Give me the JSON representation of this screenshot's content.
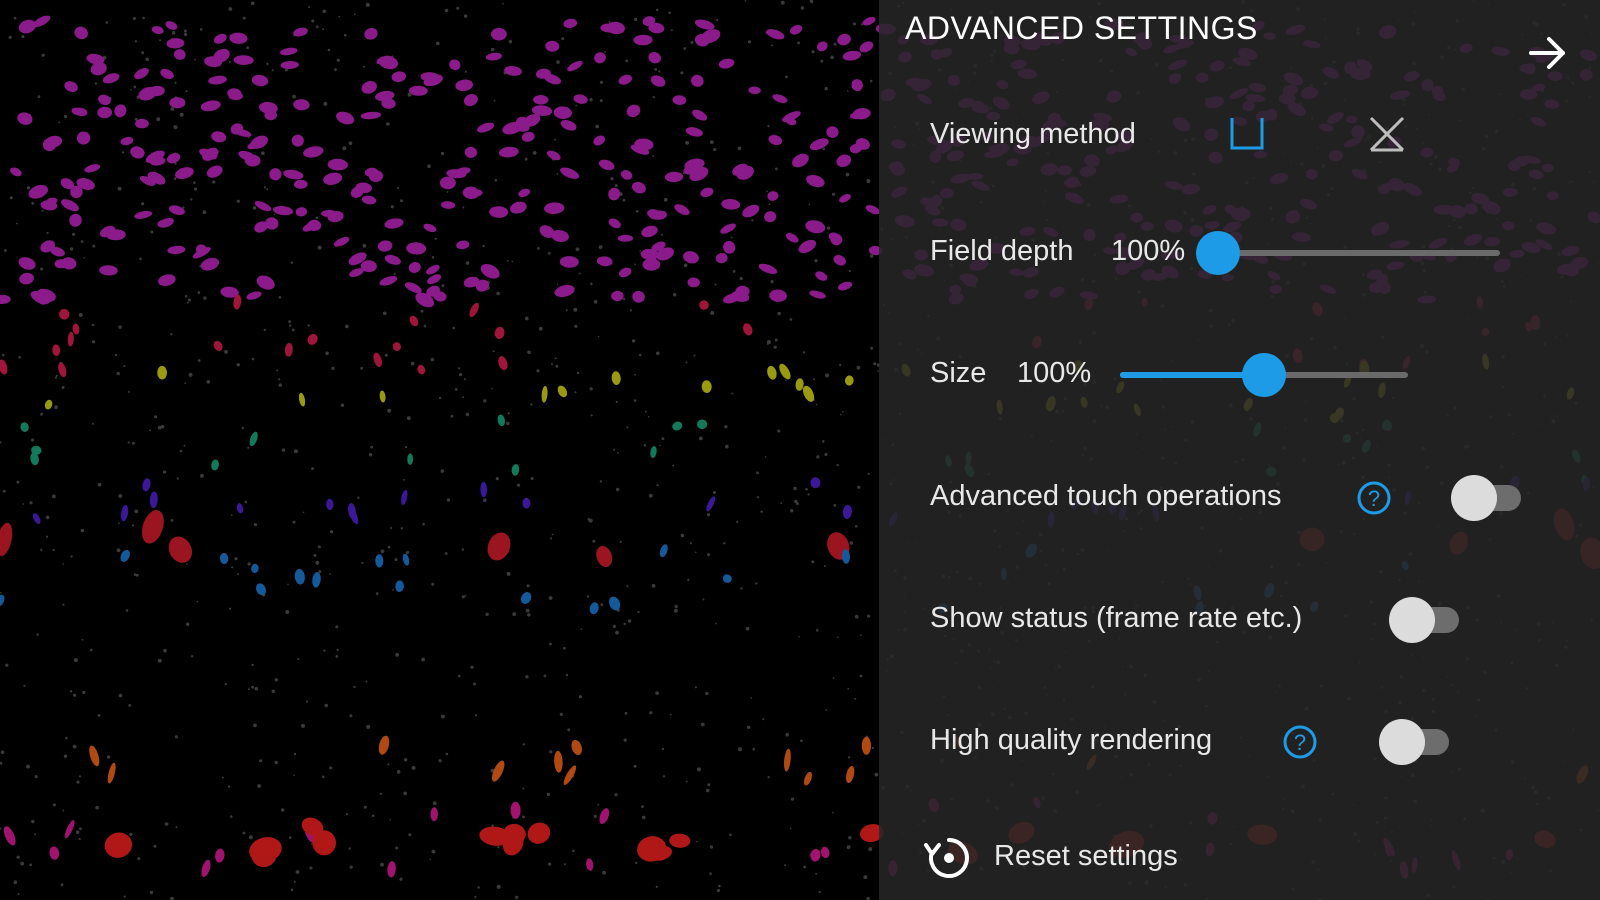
{
  "panel": {
    "title": "ADVANCED SETTINGS",
    "close_icon": "arrow-right-icon"
  },
  "viewing_method": {
    "label": "Viewing method",
    "options": [
      {
        "icon": "parallel-view-icon",
        "selected": true
      },
      {
        "icon": "cross-view-icon",
        "selected": false
      }
    ]
  },
  "field_depth": {
    "label": "Field depth",
    "value_text": "100%",
    "level": 0.0
  },
  "size": {
    "label": "Size",
    "value_text": "100%",
    "level": 0.5
  },
  "advanced_touch": {
    "label": "Advanced touch operations",
    "help_icon": "question-circle-icon",
    "enabled": false
  },
  "show_status": {
    "label": "Show status (frame rate etc.)",
    "enabled": false
  },
  "high_quality": {
    "label": "High quality rendering",
    "help_icon": "question-circle-icon",
    "enabled": false
  },
  "reset": {
    "label": "Reset settings",
    "icon": "reset-icon"
  },
  "colors": {
    "accent": "#1e9be6",
    "panel_bg": "#262626",
    "scene_bg": "#000000",
    "toggle_off_thumb": "#dcdcdc",
    "toggle_off_track": "#6d6d6d"
  }
}
